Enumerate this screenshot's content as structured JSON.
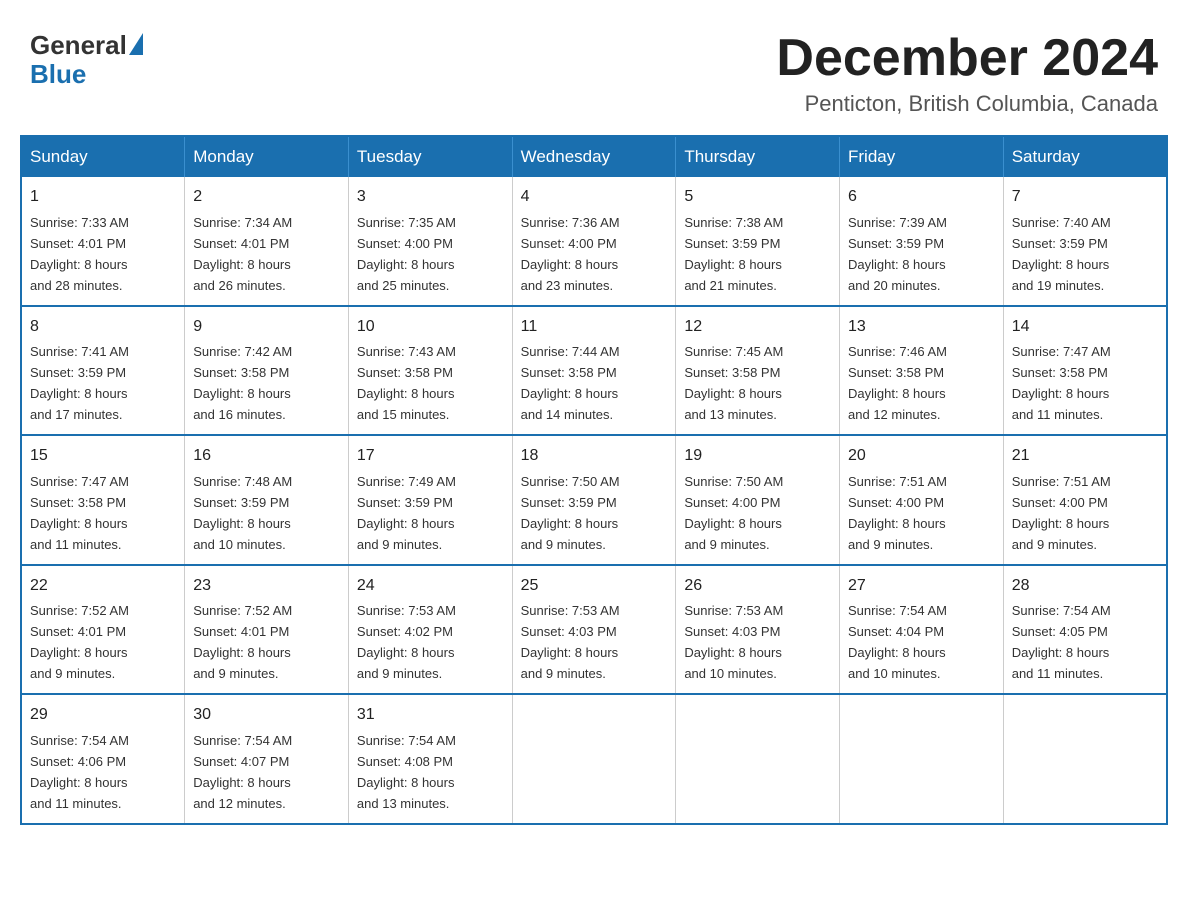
{
  "header": {
    "logo_general": "General",
    "logo_blue": "Blue",
    "month_title": "December 2024",
    "location": "Penticton, British Columbia, Canada"
  },
  "days_of_week": [
    "Sunday",
    "Monday",
    "Tuesday",
    "Wednesday",
    "Thursday",
    "Friday",
    "Saturday"
  ],
  "weeks": [
    [
      {
        "day": "1",
        "sunrise": "7:33 AM",
        "sunset": "4:01 PM",
        "daylight": "8 hours and 28 minutes."
      },
      {
        "day": "2",
        "sunrise": "7:34 AM",
        "sunset": "4:01 PM",
        "daylight": "8 hours and 26 minutes."
      },
      {
        "day": "3",
        "sunrise": "7:35 AM",
        "sunset": "4:00 PM",
        "daylight": "8 hours and 25 minutes."
      },
      {
        "day": "4",
        "sunrise": "7:36 AM",
        "sunset": "4:00 PM",
        "daylight": "8 hours and 23 minutes."
      },
      {
        "day": "5",
        "sunrise": "7:38 AM",
        "sunset": "3:59 PM",
        "daylight": "8 hours and 21 minutes."
      },
      {
        "day": "6",
        "sunrise": "7:39 AM",
        "sunset": "3:59 PM",
        "daylight": "8 hours and 20 minutes."
      },
      {
        "day": "7",
        "sunrise": "7:40 AM",
        "sunset": "3:59 PM",
        "daylight": "8 hours and 19 minutes."
      }
    ],
    [
      {
        "day": "8",
        "sunrise": "7:41 AM",
        "sunset": "3:59 PM",
        "daylight": "8 hours and 17 minutes."
      },
      {
        "day": "9",
        "sunrise": "7:42 AM",
        "sunset": "3:58 PM",
        "daylight": "8 hours and 16 minutes."
      },
      {
        "day": "10",
        "sunrise": "7:43 AM",
        "sunset": "3:58 PM",
        "daylight": "8 hours and 15 minutes."
      },
      {
        "day": "11",
        "sunrise": "7:44 AM",
        "sunset": "3:58 PM",
        "daylight": "8 hours and 14 minutes."
      },
      {
        "day": "12",
        "sunrise": "7:45 AM",
        "sunset": "3:58 PM",
        "daylight": "8 hours and 13 minutes."
      },
      {
        "day": "13",
        "sunrise": "7:46 AM",
        "sunset": "3:58 PM",
        "daylight": "8 hours and 12 minutes."
      },
      {
        "day": "14",
        "sunrise": "7:47 AM",
        "sunset": "3:58 PM",
        "daylight": "8 hours and 11 minutes."
      }
    ],
    [
      {
        "day": "15",
        "sunrise": "7:47 AM",
        "sunset": "3:58 PM",
        "daylight": "8 hours and 11 minutes."
      },
      {
        "day": "16",
        "sunrise": "7:48 AM",
        "sunset": "3:59 PM",
        "daylight": "8 hours and 10 minutes."
      },
      {
        "day": "17",
        "sunrise": "7:49 AM",
        "sunset": "3:59 PM",
        "daylight": "8 hours and 9 minutes."
      },
      {
        "day": "18",
        "sunrise": "7:50 AM",
        "sunset": "3:59 PM",
        "daylight": "8 hours and 9 minutes."
      },
      {
        "day": "19",
        "sunrise": "7:50 AM",
        "sunset": "4:00 PM",
        "daylight": "8 hours and 9 minutes."
      },
      {
        "day": "20",
        "sunrise": "7:51 AM",
        "sunset": "4:00 PM",
        "daylight": "8 hours and 9 minutes."
      },
      {
        "day": "21",
        "sunrise": "7:51 AM",
        "sunset": "4:00 PM",
        "daylight": "8 hours and 9 minutes."
      }
    ],
    [
      {
        "day": "22",
        "sunrise": "7:52 AM",
        "sunset": "4:01 PM",
        "daylight": "8 hours and 9 minutes."
      },
      {
        "day": "23",
        "sunrise": "7:52 AM",
        "sunset": "4:01 PM",
        "daylight": "8 hours and 9 minutes."
      },
      {
        "day": "24",
        "sunrise": "7:53 AM",
        "sunset": "4:02 PM",
        "daylight": "8 hours and 9 minutes."
      },
      {
        "day": "25",
        "sunrise": "7:53 AM",
        "sunset": "4:03 PM",
        "daylight": "8 hours and 9 minutes."
      },
      {
        "day": "26",
        "sunrise": "7:53 AM",
        "sunset": "4:03 PM",
        "daylight": "8 hours and 10 minutes."
      },
      {
        "day": "27",
        "sunrise": "7:54 AM",
        "sunset": "4:04 PM",
        "daylight": "8 hours and 10 minutes."
      },
      {
        "day": "28",
        "sunrise": "7:54 AM",
        "sunset": "4:05 PM",
        "daylight": "8 hours and 11 minutes."
      }
    ],
    [
      {
        "day": "29",
        "sunrise": "7:54 AM",
        "sunset": "4:06 PM",
        "daylight": "8 hours and 11 minutes."
      },
      {
        "day": "30",
        "sunrise": "7:54 AM",
        "sunset": "4:07 PM",
        "daylight": "8 hours and 12 minutes."
      },
      {
        "day": "31",
        "sunrise": "7:54 AM",
        "sunset": "4:08 PM",
        "daylight": "8 hours and 13 minutes."
      },
      null,
      null,
      null,
      null
    ]
  ],
  "labels": {
    "sunrise": "Sunrise:",
    "sunset": "Sunset:",
    "daylight": "Daylight:"
  }
}
